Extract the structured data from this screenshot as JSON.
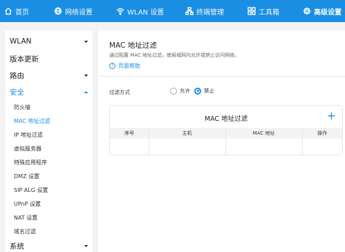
{
  "topnav": {
    "items": [
      {
        "label": "首页",
        "icon": "home-icon"
      },
      {
        "label": "网络设置",
        "icon": "globe-icon"
      },
      {
        "label": "WLAN 设置",
        "icon": "wifi-icon"
      },
      {
        "label": "终端管理",
        "icon": "devices-icon"
      },
      {
        "label": "工具箱",
        "icon": "toolbox-icon"
      },
      {
        "label": "高级设置",
        "icon": "gear-icon"
      }
    ],
    "active": "高级设置",
    "bg_color": "#1a8ee3"
  },
  "sidebar": {
    "items": [
      {
        "label": "WLAN",
        "expandable": true
      },
      {
        "label": "版本更新",
        "expandable": false
      },
      {
        "label": "路由",
        "expandable": true
      },
      {
        "label": "安全",
        "expandable": true,
        "expanded": true
      },
      {
        "label": "防火墙"
      },
      {
        "label": "MAC 地址过滤",
        "active": true
      },
      {
        "label": "IP 地址过滤"
      },
      {
        "label": "虚拟服务器"
      },
      {
        "label": "特殊应用程序"
      },
      {
        "label": "DMZ 设置"
      },
      {
        "label": "SIP ALG 设置"
      },
      {
        "label": "UPnP 设置"
      },
      {
        "label": "NAT 设置"
      },
      {
        "label": "域名过滤"
      },
      {
        "label": "系统",
        "expandable": true
      }
    ]
  },
  "main": {
    "title": "MAC 地址过滤",
    "description": "通过配置 MAC 地址过滤，使局域网内允许或禁止访问网络。",
    "help_label": "页面帮助",
    "filter_label": "过滤方式",
    "options": [
      "允许",
      "禁止"
    ],
    "selected_option": "禁止",
    "card_title": "MAC 地址过滤",
    "add_symbol": "+",
    "columns": [
      "序号",
      "主机",
      "MAC 地址",
      "操作"
    ]
  }
}
